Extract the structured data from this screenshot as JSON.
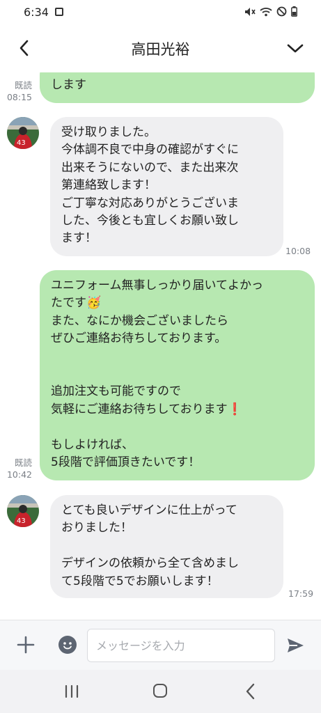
{
  "status_bar": {
    "time": "6:34"
  },
  "header": {
    "title": "高田光裕"
  },
  "messages": [
    {
      "type": "sent",
      "text": "します",
      "read": "既読",
      "time": "08:15"
    },
    {
      "type": "received",
      "text": "受け取りました。\n今体調不良で中身の確認がすぐに\n出来そうにないので、また出来次\n第連絡致します！\nご丁寧な対応ありがとうございま\nした、今後とも宜しくお願い致し\nます！",
      "time": "10:08"
    },
    {
      "type": "sent",
      "text": "ユニフォーム無事しっかり届いてよかっ\nたです🥳\nまた、なにか機会ございましたら\nぜひご連絡お待ちしております。\n\n\n追加注文も可能ですので\n気軽にご連絡お待ちしております❗\n\nもしよければ、\n5段階で評価頂きたいです！",
      "read": "既読",
      "time": "10:42"
    },
    {
      "type": "received",
      "text": "とても良いデザインに仕上がって\nおりました！\n\nデザインの依頼から全て含めまし\nて5段階で5でお願いします！",
      "time": "17:59"
    }
  ],
  "input": {
    "placeholder": "メッセージを入力"
  },
  "colors": {
    "sent_bubble": "#b7e8b1",
    "received_bubble": "#efeff1",
    "accent": "#5d6572"
  }
}
